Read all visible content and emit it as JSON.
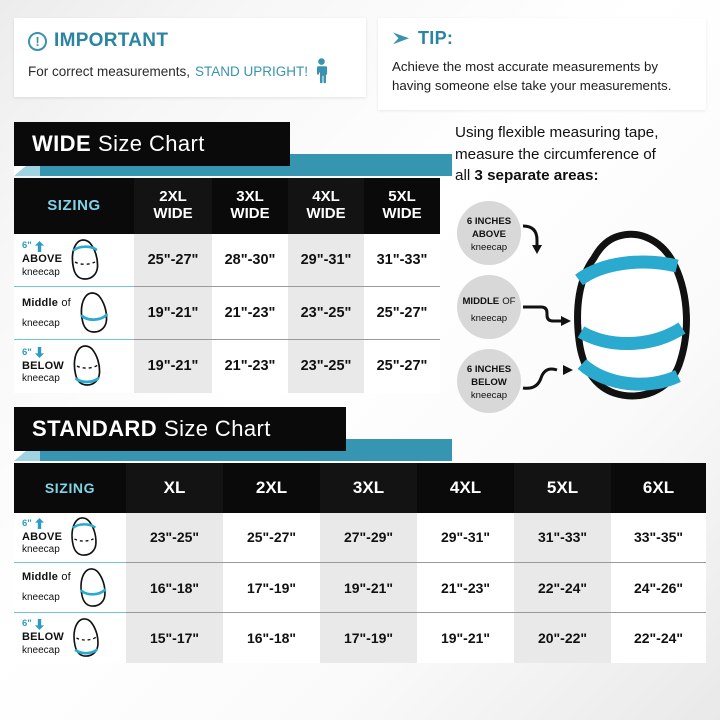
{
  "notes": {
    "important": {
      "icon": "exclamation-circle-icon",
      "glyph": "!",
      "title": "IMPORTANT",
      "body_prefix": "For correct measurements,",
      "body_highlight": "STAND UPRIGHT!",
      "person_icon": "standing-person-icon"
    },
    "tip": {
      "icon": "play-arrow-icon",
      "title": "TIP:",
      "line1": "Achieve the most accurate measurements by",
      "line2": "having someone else take your measurements."
    }
  },
  "wide_chart": {
    "banner_bold": "WIDE",
    "banner_light": "Size Chart",
    "sizing_label": "SIZING",
    "columns": [
      "2XL\nWIDE",
      "3XL\nWIDE",
      "4XL\nWIDE",
      "5XL\nWIDE"
    ],
    "columns_flat": [
      {
        "size": "2XL",
        "fit": "WIDE"
      },
      {
        "size": "3XL",
        "fit": "WIDE"
      },
      {
        "size": "4XL",
        "fit": "WIDE"
      },
      {
        "size": "5XL",
        "fit": "WIDE"
      }
    ],
    "rows": [
      {
        "marker": "6\"",
        "arrow": "up-arrow-icon",
        "name": "ABOVE",
        "name_thin": "",
        "sub": "kneecap",
        "icon": "knee-above-icon",
        "values": [
          "25\"-27\"",
          "28\"-30\"",
          "29\"-31\"",
          "31\"-33\""
        ]
      },
      {
        "marker": "",
        "arrow": "",
        "name": "Middle",
        "name_thin": "of",
        "sub": "kneecap",
        "icon": "knee-middle-icon",
        "values": [
          "19\"-21\"",
          "21\"-23\"",
          "23\"-25\"",
          "25\"-27\""
        ]
      },
      {
        "marker": "6\"",
        "arrow": "down-arrow-icon",
        "name": "BELOW",
        "name_thin": "",
        "sub": "kneecap",
        "icon": "knee-below-icon",
        "values": [
          "19\"-21\"",
          "21\"-23\"",
          "23\"-25\"",
          "25\"-27\""
        ]
      }
    ]
  },
  "standard_chart": {
    "banner_bold": "STANDARD",
    "banner_light": "Size Chart",
    "sizing_label": "SIZING",
    "columns_flat": [
      {
        "size": "XL",
        "fit": ""
      },
      {
        "size": "2XL",
        "fit": ""
      },
      {
        "size": "3XL",
        "fit": ""
      },
      {
        "size": "4XL",
        "fit": ""
      },
      {
        "size": "5XL",
        "fit": ""
      },
      {
        "size": "6XL",
        "fit": ""
      }
    ],
    "rows": [
      {
        "marker": "6\"",
        "arrow": "up-arrow-icon",
        "name": "ABOVE",
        "name_thin": "",
        "sub": "kneecap",
        "icon": "knee-above-icon",
        "values": [
          "23\"-25\"",
          "25\"-27\"",
          "27\"-29\"",
          "29\"-31\"",
          "31\"-33\"",
          "33\"-35\""
        ]
      },
      {
        "marker": "",
        "arrow": "",
        "name": "Middle",
        "name_thin": "of",
        "sub": "kneecap",
        "icon": "knee-middle-icon",
        "values": [
          "16\"-18\"",
          "17\"-19\"",
          "19\"-21\"",
          "21\"-23\"",
          "22\"-24\"",
          "24\"-26\""
        ]
      },
      {
        "marker": "6\"",
        "arrow": "down-arrow-icon",
        "name": "BELOW",
        "name_thin": "",
        "sub": "kneecap",
        "icon": "knee-below-icon",
        "values": [
          "15\"-17\"",
          "16\"-18\"",
          "17\"-19\"",
          "19\"-21\"",
          "20\"-22\"",
          "22\"-24\""
        ]
      }
    ]
  },
  "illustration": {
    "line1": "Using flexible measuring tape,",
    "line2": "measure the circumference of",
    "line3_prefix": "all ",
    "line3_bold": "3 separate areas:",
    "callouts": [
      {
        "l1_bold": "6 INCHES",
        "l2_bold": "ABOVE",
        "l3": "kneecap"
      },
      {
        "l1_bold": "MIDDLE",
        "l1_thin": "OF",
        "l2_bold": "",
        "l3": "kneecap"
      },
      {
        "l1_bold": "6 INCHES",
        "l2_bold": "BELOW",
        "l3": "kneecap"
      }
    ],
    "knee_icon": "knee-diagram-icon",
    "band_icon": "measuring-tape-band-icon"
  },
  "colors": {
    "teal": "#3695b0",
    "teal_text": "#2b85a2",
    "cyan_band": "#29aace",
    "sizing_cyan": "#7fd4e8",
    "header_black": "#0a0a0a",
    "row_alt": "#e9e9e9"
  }
}
